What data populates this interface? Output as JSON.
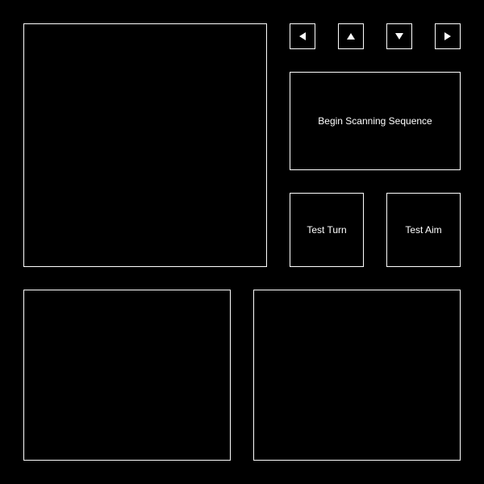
{
  "controls": {
    "arrows": {
      "left_icon": "arrow-left-icon",
      "up_icon": "arrow-up-icon",
      "down_icon": "arrow-down-icon",
      "right_icon": "arrow-right-icon"
    },
    "begin_scan_label": "Begin Scanning Sequence",
    "test_turn_label": "Test Turn",
    "test_aim_label": "Test Aim"
  },
  "colors": {
    "background": "#000000",
    "foreground": "#ffffff"
  }
}
